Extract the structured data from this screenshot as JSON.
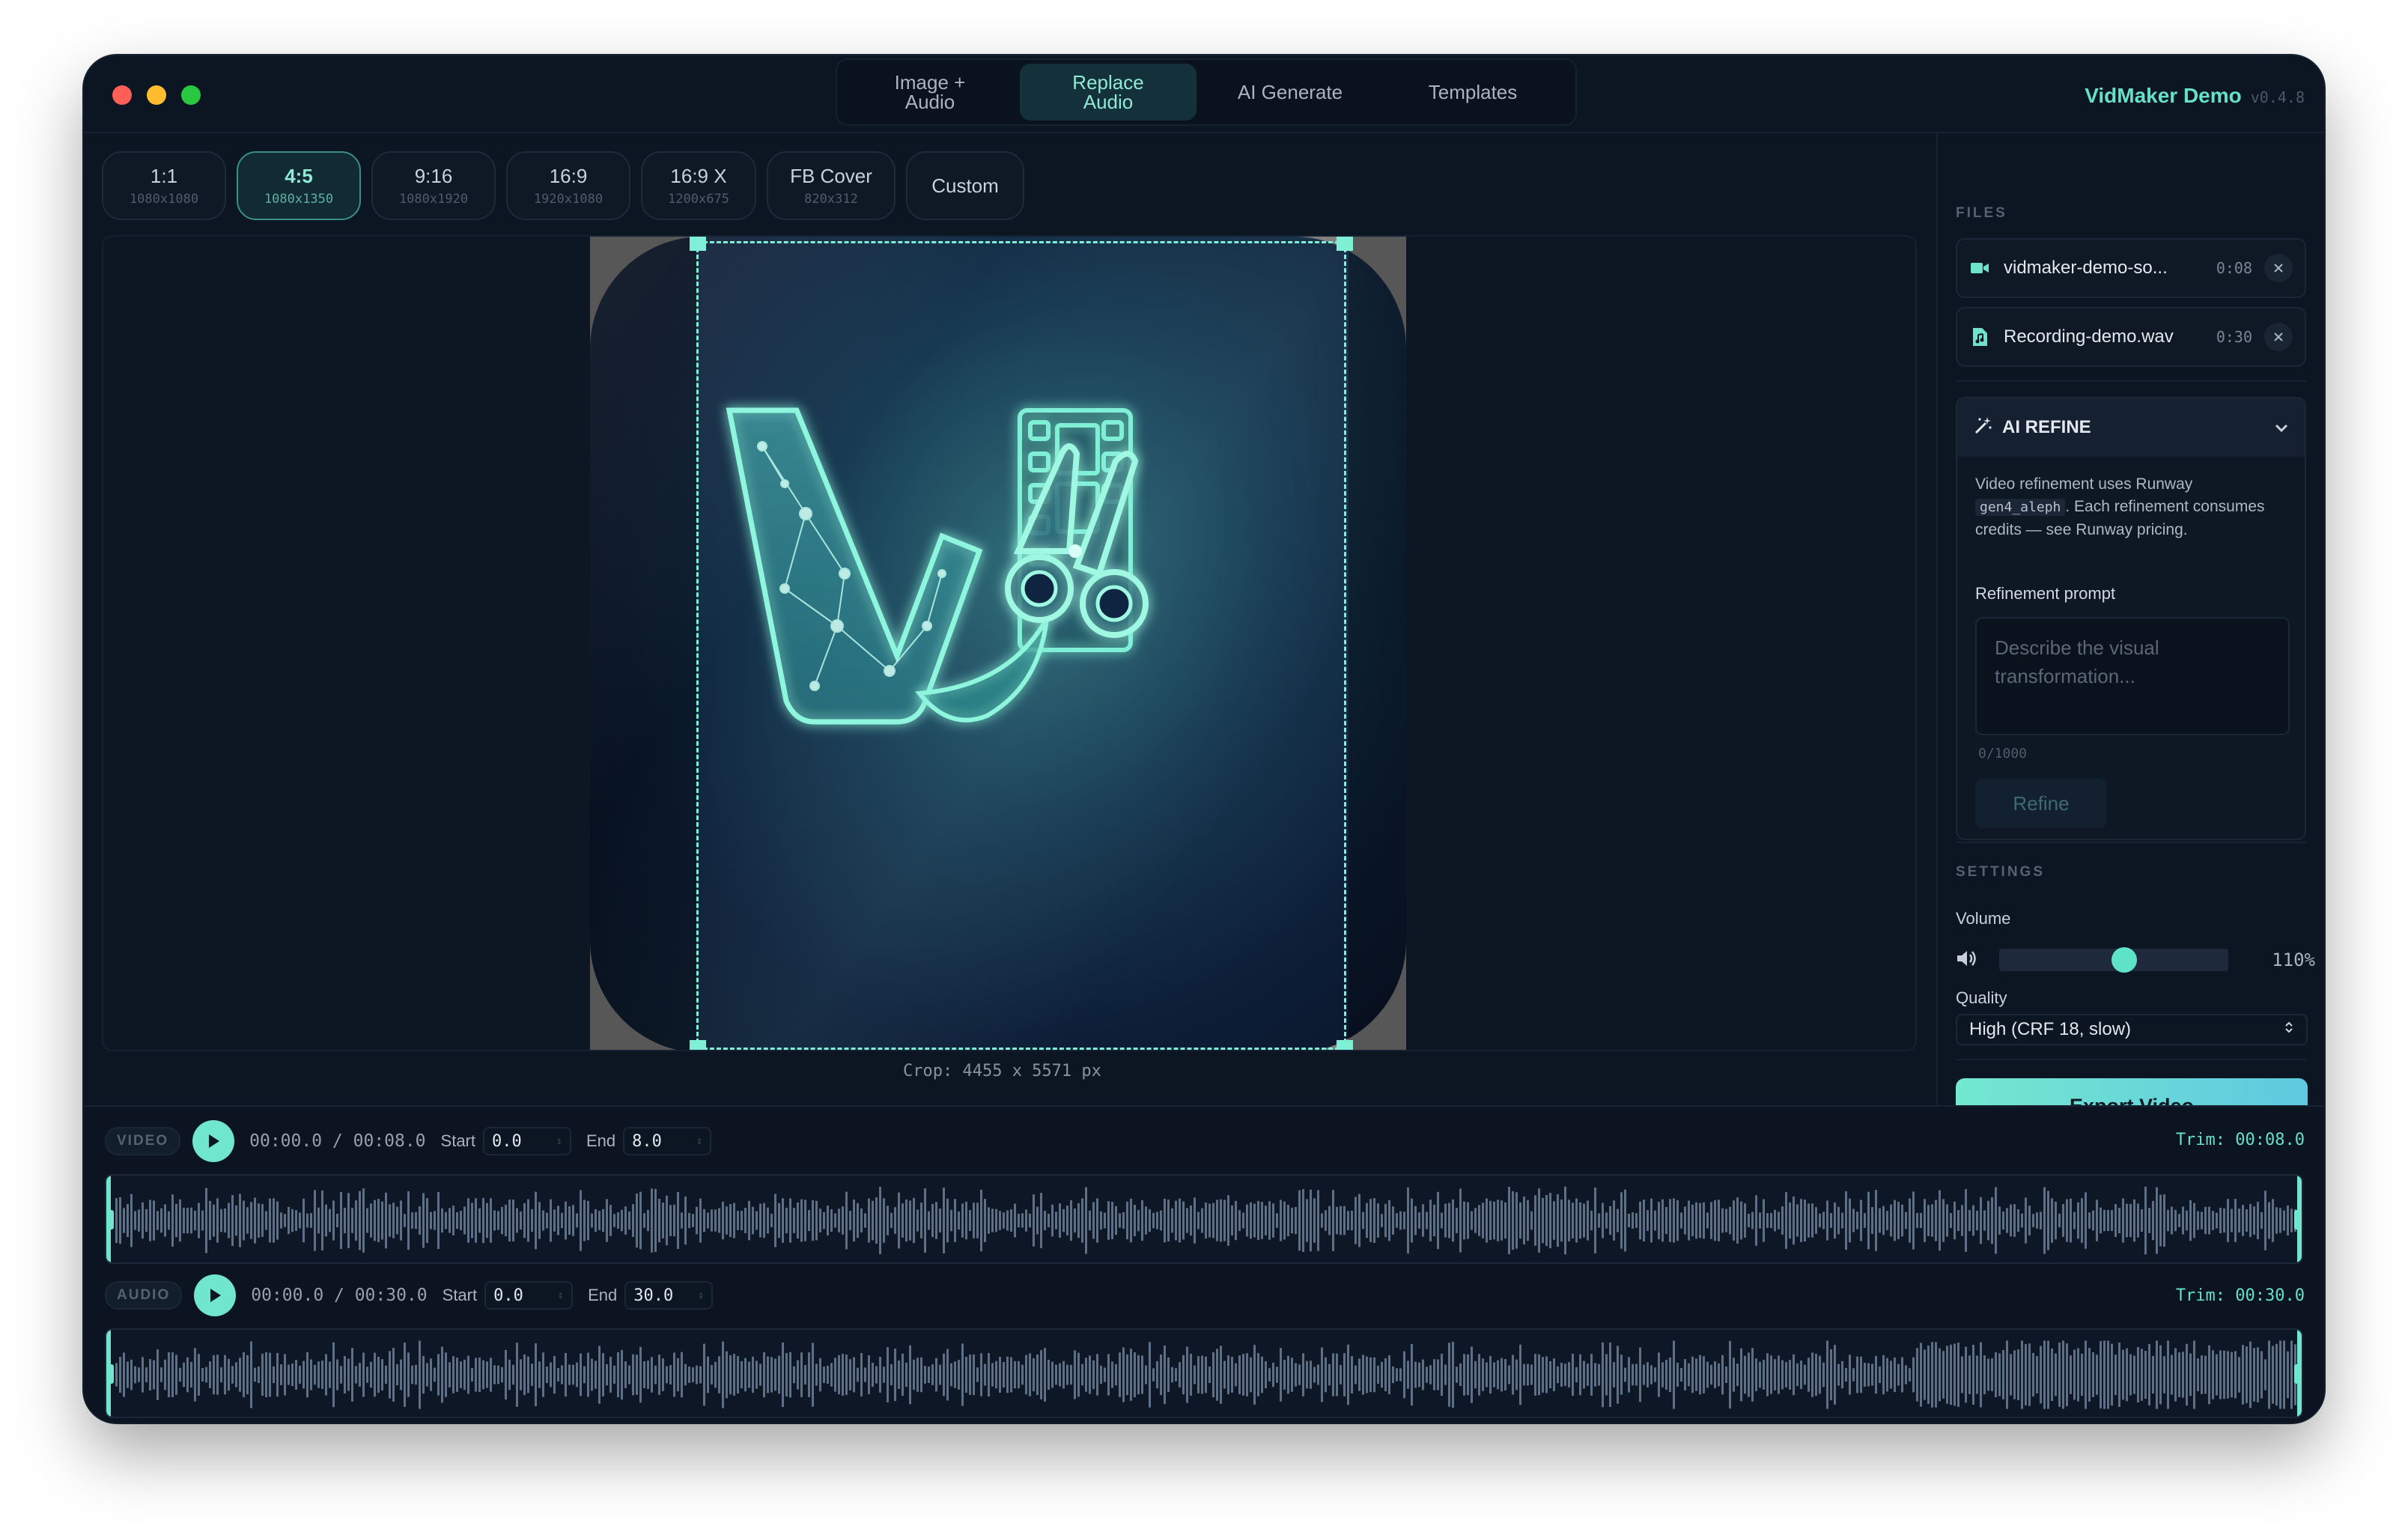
{
  "window": {
    "brand": "VidMaker Demo",
    "version": "v0.4.8"
  },
  "mode_tabs": [
    {
      "label": "Image +\nAudio",
      "active": false
    },
    {
      "label": "Replace\nAudio",
      "active": true
    },
    {
      "label": "AI Generate",
      "active": false
    },
    {
      "label": "Templates",
      "active": false
    }
  ],
  "presets": [
    {
      "label": "1:1",
      "size": "1080x1080",
      "active": false
    },
    {
      "label": "4:5",
      "size": "1080x1350",
      "active": true
    },
    {
      "label": "9:16",
      "size": "1080x1920",
      "active": false
    },
    {
      "label": "16:9",
      "size": "1920x1080",
      "active": false
    },
    {
      "label": "16:9 X",
      "size": "1200x675",
      "active": false
    },
    {
      "label": "FB Cover",
      "size": "820x312",
      "active": false
    },
    {
      "label": "Custom",
      "size": "",
      "active": false
    }
  ],
  "canvas": {
    "crop_info": "Crop: 4455 x 5571 px"
  },
  "files": {
    "label": "FILES",
    "items": [
      {
        "name": "vidmaker-demo-so...",
        "duration": "0:08",
        "icon": "video-icon"
      },
      {
        "name": "Recording-demo.wav",
        "duration": "0:30",
        "icon": "audio-file-icon"
      }
    ]
  },
  "ai_refine": {
    "title": "AI REFINE",
    "desc_before": "Video refinement uses Runway ",
    "desc_code": "gen4_aleph",
    "desc_after": ". Each refinement consumes credits — see Runway pricing.",
    "prompt_label": "Refinement prompt",
    "placeholder": "Describe the visual transformation...",
    "counter": "0/1000",
    "refine_button": "Refine"
  },
  "settings": {
    "label": "SETTINGS",
    "volume_label": "Volume",
    "volume_value": "110%",
    "volume_fraction": 0.55,
    "quality_label": "Quality",
    "quality_value": "High (CRF 18, slow)",
    "export_button": "Export Video"
  },
  "timeline": {
    "video": {
      "tag": "VIDEO",
      "timecode": "00:00.0 / 00:08.0",
      "start_label": "Start",
      "start_value": "0.0",
      "end_label": "End",
      "end_value": "8.0",
      "trim": "Trim: 00:08.0"
    },
    "audio": {
      "tag": "AUDIO",
      "timecode": "00:00.0 / 00:30.0",
      "start_label": "Start",
      "start_value": "0.0",
      "end_label": "End",
      "end_value": "30.0",
      "trim": "Trim: 00:30.0"
    }
  },
  "colors": {
    "accent": "#70e6cf",
    "window_bg": "#0c1522",
    "wave_bar": "#5e6f86"
  }
}
